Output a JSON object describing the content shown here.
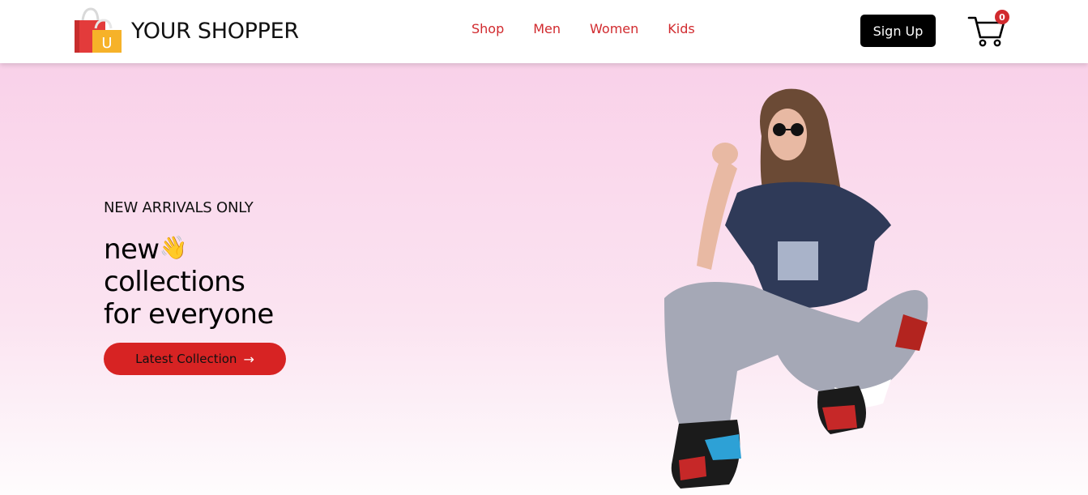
{
  "header": {
    "logo_text": "YOUR SHOPPER",
    "logo_letter": "U",
    "nav": [
      {
        "label": "Shop"
      },
      {
        "label": "Men"
      },
      {
        "label": "Women"
      },
      {
        "label": "Kids"
      }
    ],
    "signup_label": "Sign Up",
    "cart_count": "0"
  },
  "hero": {
    "subtitle": "NEW ARRIVALS ONLY",
    "title_line1": "new",
    "title_line2": "collections",
    "title_line3": "for everyone",
    "cta_label": "Latest Collection",
    "cta_arrow": "→"
  },
  "colors": {
    "accent": "#d72323",
    "nav_text": "#d12a2e",
    "hero_bg_top": "#f9d1e9",
    "button_dark": "#000000"
  },
  "icons": {
    "logo": "shopping-bags-icon",
    "wave": "waving-hand-icon",
    "cart": "shopping-cart-icon",
    "arrow": "arrow-right-icon"
  }
}
